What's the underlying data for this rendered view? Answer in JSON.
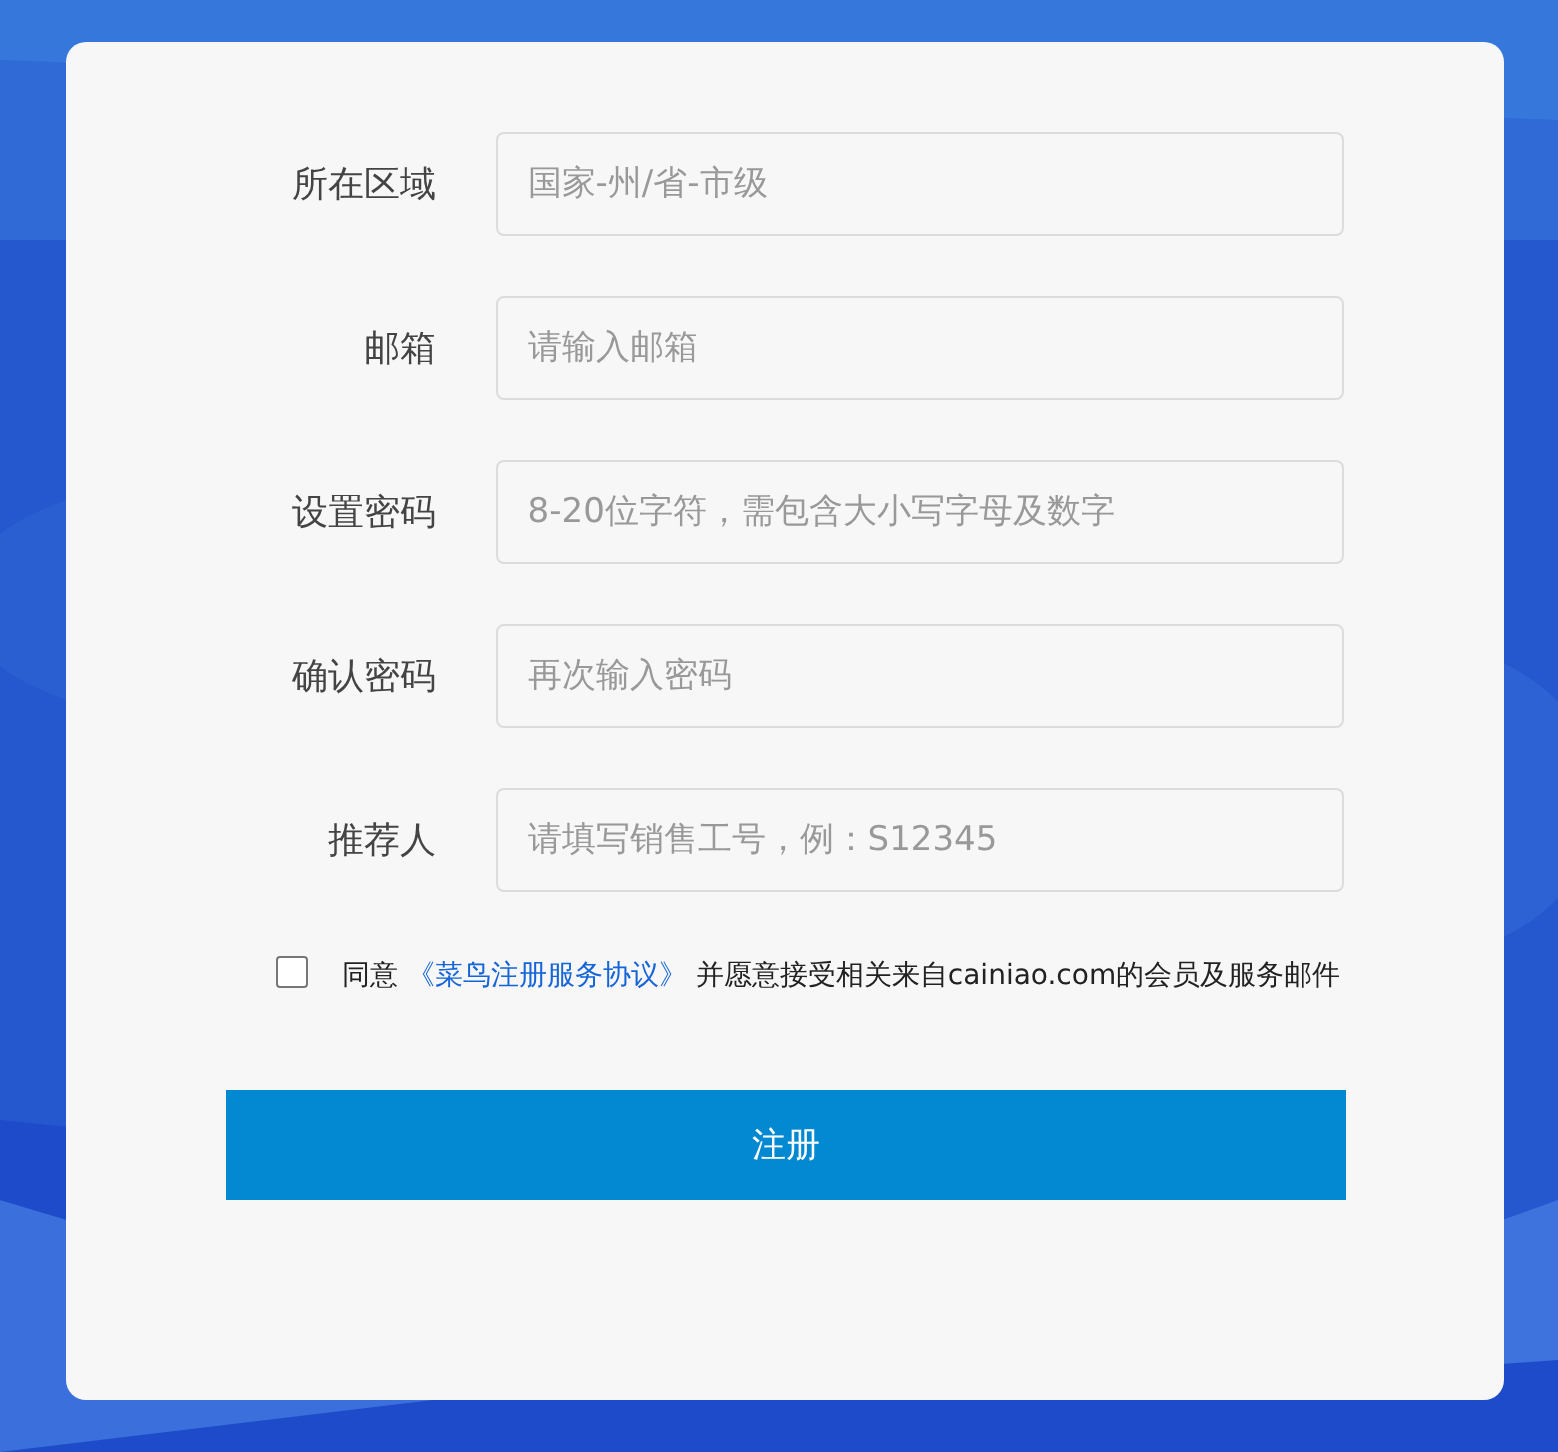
{
  "fields": [
    {
      "label": "所在区域",
      "placeholder": "国家-州/省-市级"
    },
    {
      "label": "邮箱",
      "placeholder": "请输入邮箱"
    },
    {
      "label": "设置密码",
      "placeholder": "8-20位字符，需包含大小写字母及数字"
    },
    {
      "label": "确认密码",
      "placeholder": "再次输入密码"
    },
    {
      "label": "推荐人",
      "placeholder": "请填写销售工号，例：S12345"
    }
  ],
  "agreement": {
    "checked": false,
    "prefix": "同意 ",
    "link": "《菜鸟注册服务协议》",
    "suffix": " 并愿意接受相关来自cainiao.com的会员及服务邮件"
  },
  "submit": "注册"
}
